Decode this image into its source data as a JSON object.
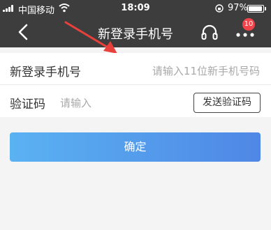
{
  "status_bar": {
    "carrier": "中国移动",
    "time": "18:09",
    "battery_percent": "97%",
    "battery_level": 0.97,
    "icons": [
      "signal-icon",
      "wifi-icon",
      "rotation-lock-icon",
      "battery-icon"
    ]
  },
  "nav": {
    "title": "新登录手机号",
    "badge_count": "10",
    "icons": [
      "back-icon",
      "headset-icon",
      "more-icon"
    ]
  },
  "form": {
    "phone_label": "新登录手机号",
    "phone_placeholder": "请输入11位新手机号码",
    "code_label": "验证码",
    "code_placeholder": "请输入",
    "send_code_label": "发送验证码"
  },
  "confirm_label": "确定",
  "colors": {
    "header_bg": "#3d3d3d",
    "accent_start": "#5ab2f2",
    "accent_end": "#4f87e6",
    "badge": "#f0434a",
    "annotation_arrow": "#e8403b"
  }
}
